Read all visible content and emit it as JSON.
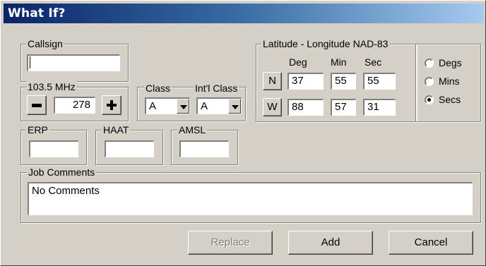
{
  "window": {
    "title": "What If?"
  },
  "callsign": {
    "legend": "Callsign",
    "value": ""
  },
  "frequency": {
    "legend": "103.5 MHz",
    "channel": "278"
  },
  "class": {
    "legend": "Class",
    "value": "A"
  },
  "intl_class": {
    "legend": "Int'l Class",
    "value": "A"
  },
  "erp": {
    "legend": "ERP",
    "value": ""
  },
  "haat": {
    "legend": "HAAT",
    "value": ""
  },
  "amsl": {
    "legend": "AMSL",
    "value": ""
  },
  "latlon": {
    "legend": "Latitude - Longitude NAD-83",
    "col_deg": "Deg",
    "col_min": "Min",
    "col_sec": "Sec",
    "lat": {
      "hemi": "N",
      "deg": "37",
      "min": "55",
      "sec": "55"
    },
    "lon": {
      "hemi": "W",
      "deg": "88",
      "min": "57",
      "sec": "31"
    }
  },
  "units": {
    "options": [
      "Degs",
      "Mins",
      "Secs"
    ],
    "selected": "Secs"
  },
  "comments": {
    "legend": "Job Comments",
    "value": "No Comments"
  },
  "buttons": {
    "replace": "Replace",
    "add": "Add",
    "cancel": "Cancel"
  },
  "colors": {
    "titlebar_start": "#0a246a",
    "titlebar_end": "#a6caf0",
    "face": "#d4d0c8",
    "disabled_text": "#808080"
  }
}
